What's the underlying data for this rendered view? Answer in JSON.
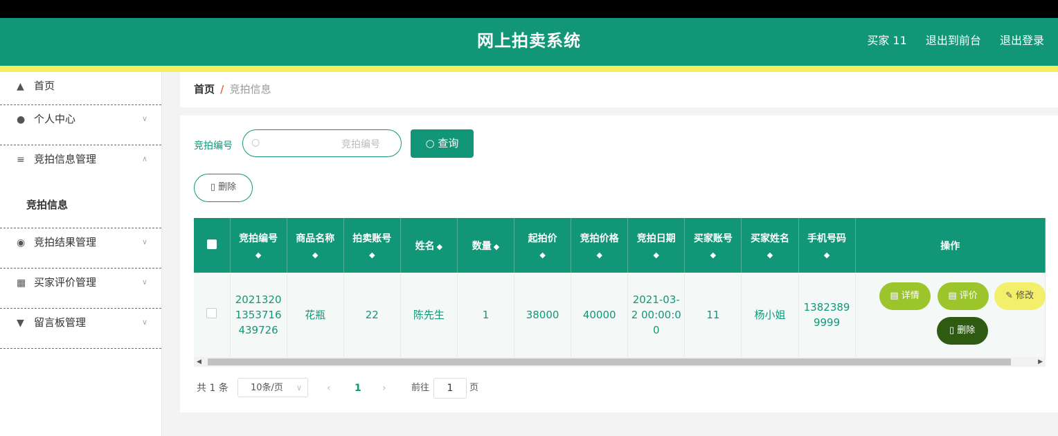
{
  "header": {
    "title": "网上拍卖系统",
    "user": "买家 11",
    "to_front": "退出到前台",
    "logout": "退出登录"
  },
  "sidebar": {
    "items": [
      {
        "label": "首页",
        "icon": "home-icon"
      },
      {
        "label": "个人中心",
        "icon": "user-icon"
      },
      {
        "label": "竞拍信息管理",
        "icon": "list-icon"
      },
      {
        "label": "竞拍结果管理",
        "icon": "pin-icon"
      },
      {
        "label": "买家评价管理",
        "icon": "clipboard-icon"
      },
      {
        "label": "留言板管理",
        "icon": "board-icon"
      }
    ],
    "sub_item": "竞拍信息"
  },
  "breadcrumb": {
    "home": "首页",
    "separator": "/",
    "current": "竞拍信息"
  },
  "search": {
    "label": "竞拍编号",
    "placeholder": "竞拍编号",
    "button": "查询"
  },
  "toolbar": {
    "delete": "删除"
  },
  "table": {
    "columns": [
      "竞拍编号",
      "商品名称",
      "拍卖账号",
      "姓名",
      "数量",
      "起拍价",
      "竞拍价格",
      "竞拍日期",
      "买家账号",
      "买家姓名",
      "手机号码",
      "操作"
    ],
    "rows": [
      {
        "bid_no": "20213201353716439726",
        "product": "花瓶",
        "seller": "22",
        "name": "陈先生",
        "qty": "1",
        "start_price": "38000",
        "bid_price": "40000",
        "date": "2021-03-2 00:00:00",
        "buyer_account": "11",
        "buyer_name": "杨小姐",
        "phone": "13823899999"
      }
    ],
    "actions": {
      "detail": "详情",
      "review": "评价",
      "edit": "修改",
      "delete": "删除"
    }
  },
  "pagination": {
    "total": "共 1 条",
    "page_size": "10条/页",
    "current": "1",
    "goto_label": "前往",
    "goto_value": "1",
    "page_unit": "页"
  },
  "colors": {
    "primary": "#119778",
    "accent_yellow": "#f5ef5e",
    "op_green": "#9bc52a",
    "op_dark": "#2e5a12"
  }
}
